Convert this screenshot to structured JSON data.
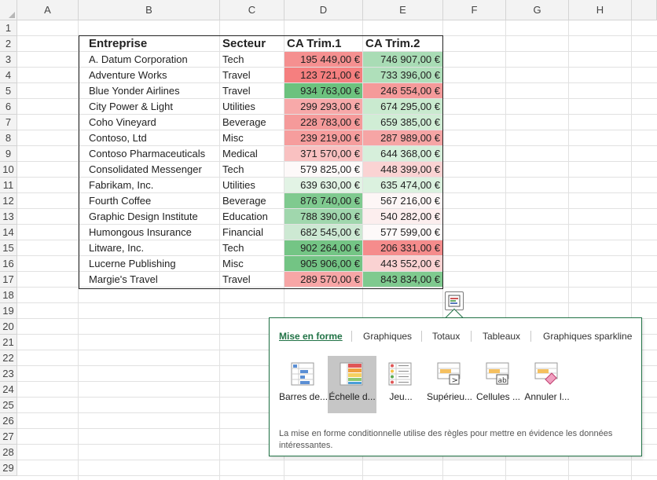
{
  "columns": [
    "A",
    "B",
    "C",
    "D",
    "E",
    "F",
    "G",
    "H"
  ],
  "rows": [
    "1",
    "2",
    "3",
    "4",
    "5",
    "6",
    "7",
    "8",
    "9",
    "10",
    "11",
    "12",
    "13",
    "14",
    "15",
    "16",
    "17",
    "18",
    "19",
    "20",
    "21",
    "22",
    "23",
    "24",
    "25",
    "26",
    "27",
    "28",
    "29"
  ],
  "table": {
    "headers": [
      "Entreprise",
      "Secteur",
      "CA Trim.1",
      "CA Trim.2"
    ],
    "rows": [
      {
        "entreprise": "A. Datum Corporation",
        "secteur": "Tech",
        "t1": "195 449,00 €",
        "t2": "746 907,00 €",
        "c1": "#f59090",
        "c2": "#a9dcb5"
      },
      {
        "entreprise": "Adventure Works",
        "secteur": "Travel",
        "t1": "123 721,00 €",
        "t2": "733 396,00 €",
        "c1": "#f57f7f",
        "c2": "#afdfba"
      },
      {
        "entreprise": "Blue Yonder Airlines",
        "secteur": "Travel",
        "t1": "934 763,00 €",
        "t2": "246 554,00 €",
        "c1": "#6cc27e",
        "c2": "#f59a9a"
      },
      {
        "entreprise": "City Power & Light",
        "secteur": "Utilities",
        "t1": "299 293,00 €",
        "t2": "674 295,00 €",
        "c1": "#f7a9a9",
        "c2": "#c9eacf"
      },
      {
        "entreprise": "Coho Vineyard",
        "secteur": "Beverage",
        "t1": "228 783,00 €",
        "t2": "659 385,00 €",
        "c1": "#f59a9a",
        "c2": "#d0edd5"
      },
      {
        "entreprise": "Contoso, Ltd",
        "secteur": "Misc",
        "t1": "239 219,00 €",
        "t2": "287 989,00 €",
        "c1": "#f69d9d",
        "c2": "#f6a5a5"
      },
      {
        "entreprise": "Contoso Pharmaceuticals",
        "secteur": "Medical",
        "t1": "371 570,00 €",
        "t2": "644 368,00 €",
        "c1": "#f9c1c1",
        "c2": "#d6efdb"
      },
      {
        "entreprise": "Consolidated Messenger",
        "secteur": "Tech",
        "t1": "579 825,00 €",
        "t2": "448 399,00 €",
        "c1": "#fdf9f9",
        "c2": "#fad3d3"
      },
      {
        "entreprise": "Fabrikam, Inc.",
        "secteur": "Utilities",
        "t1": "639 630,00 €",
        "t2": "635 474,00 €",
        "c1": "#e2f3e5",
        "c2": "#dbf1df"
      },
      {
        "entreprise": "Fourth Coffee",
        "secteur": "Beverage",
        "t1": "876 740,00 €",
        "t2": "567 216,00 €",
        "c1": "#7fca8f",
        "c2": "#fdf6f6"
      },
      {
        "entreprise": "Graphic Design Institute",
        "secteur": "Education",
        "t1": "788 390,00 €",
        "t2": "540 282,00 €",
        "c1": "#a0d7ad",
        "c2": "#fceeee"
      },
      {
        "entreprise": "Humongous Insurance",
        "secteur": "Financial",
        "t1": "682 545,00 €",
        "t2": "577 599,00 €",
        "c1": "#cde9d3",
        "c2": "#fdf9f9"
      },
      {
        "entreprise": "Litware, Inc.",
        "secteur": "Tech",
        "t1": "902 264,00 €",
        "t2": "206 331,00 €",
        "c1": "#74c585",
        "c2": "#f58c8c"
      },
      {
        "entreprise": "Lucerne Publishing",
        "secteur": "Misc",
        "t1": "905 906,00 €",
        "t2": "443 552,00 €",
        "c1": "#73c484",
        "c2": "#fad2d2"
      },
      {
        "entreprise": "Margie's Travel",
        "secteur": "Travel",
        "t1": "289 570,00 €",
        "t2": "843 834,00 €",
        "c1": "#f7a6a6",
        "c2": "#7fca8f"
      }
    ]
  },
  "quick_analysis": {
    "button_icon": "quick-analysis-icon",
    "tabs": [
      "Mise en forme",
      "Graphiques",
      "Totaux",
      "Tableaux",
      "Graphiques sparkline"
    ],
    "active_tab": "Mise en forme",
    "options": [
      {
        "label": "Barres de...",
        "icon": "data-bars-icon"
      },
      {
        "label": "Échelle d...",
        "icon": "color-scale-icon",
        "selected": true
      },
      {
        "label": "Jeu...",
        "icon": "icon-set-icon"
      },
      {
        "label": "Supérieu...",
        "icon": "greater-than-icon"
      },
      {
        "label": "Cellules ...",
        "icon": "text-contains-icon"
      },
      {
        "label": "Annuler l...",
        "icon": "clear-format-icon"
      }
    ],
    "description": "La mise en forme conditionnelle utilise des règles pour mettre en évidence les données intéressantes."
  }
}
